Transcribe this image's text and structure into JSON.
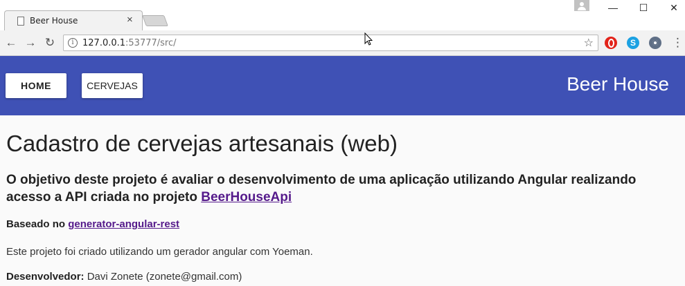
{
  "browser": {
    "tab_title": "Beer House",
    "tab_close": "×",
    "url_host": "127.0.0.1",
    "url_rest": ":53777/src/",
    "window_controls": {
      "minimize": "—",
      "maximize": "☐",
      "close": "✕"
    },
    "nav": {
      "back": "←",
      "forward": "→",
      "reload": "↻",
      "star": "☆",
      "menu": "⋮"
    },
    "extensions": [
      "opera-icon",
      "skype-icon",
      "eye-extension-icon"
    ]
  },
  "appbar": {
    "home_label": "HOME",
    "cervejas_label": "CERVEJAS",
    "brand": "Beer House",
    "color": "#3f51b5"
  },
  "main": {
    "title": "Cadastro de cervejas artesanais (web)",
    "objective_text": "O objetivo deste projeto é avaliar o desenvolvimento de uma aplicação utilizando Angular realizando acesso a API criada no projeto ",
    "objective_link": "BeerHouseApi",
    "based_prefix": "Baseado no ",
    "based_link": "generator-angular-rest",
    "note": "Este projeto foi criado utilizando um gerador angular com Yoeman.",
    "dev_label": "Desenvolvedor:",
    "dev_value": " Davi Zonete (zonete@gmail.com)"
  }
}
